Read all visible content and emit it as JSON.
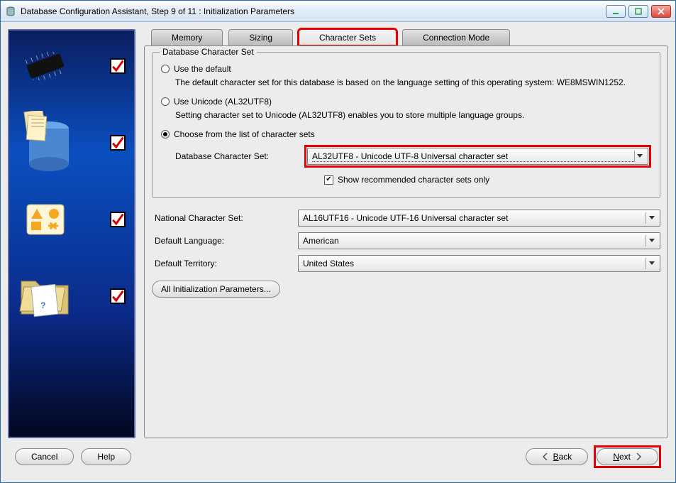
{
  "window": {
    "title": "Database Configuration Assistant, Step 9 of 11 : Initialization Parameters"
  },
  "tabs": {
    "memory": "Memory",
    "sizing": "Sizing",
    "charsets": "Character Sets",
    "connmode": "Connection Mode"
  },
  "group": {
    "legend": "Database Character Set"
  },
  "opt1": {
    "label": "Use the default",
    "desc": "The default character set for this database is based on the language setting of this operating system: WE8MSWIN1252."
  },
  "opt2": {
    "label": "Use Unicode (AL32UTF8)",
    "desc": "Setting character set to Unicode (AL32UTF8) enables you to store multiple language groups."
  },
  "opt3": {
    "label": "Choose from the list of character sets"
  },
  "dbcs": {
    "label": "Database Character Set:",
    "value": "AL32UTF8 - Unicode UTF-8 Universal character set"
  },
  "showrec": {
    "label": "Show recommended character sets only"
  },
  "ncs": {
    "label": "National Character Set:",
    "value": "AL16UTF16 - Unicode UTF-16 Universal character set"
  },
  "lang": {
    "label": "Default Language:",
    "value": "American"
  },
  "terr": {
    "label": "Default Territory:",
    "value": "United States"
  },
  "allparams": {
    "label": "All Initialization Parameters..."
  },
  "buttons": {
    "cancel": "Cancel",
    "help": "Help",
    "back": "ack",
    "back_u": "B",
    "next": "ext",
    "next_u": "N"
  }
}
